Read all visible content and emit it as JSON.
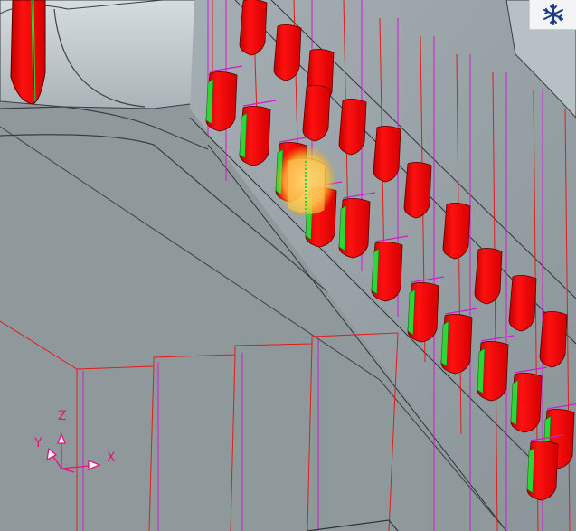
{
  "view_tool": {
    "icon": "navigation-cube-icon"
  },
  "triad": {
    "axis_x": "X",
    "axis_y": "Y",
    "axis_z": "Z"
  },
  "colors": {
    "background": "#8f999c",
    "part_surface": "#9aa4a8",
    "part_highlight": "#c3ccd0",
    "feature_red": "#ff0000",
    "feature_green": "#2fd635",
    "edge_magenta": "#d21ad2",
    "sketch_red": "#e31b1b",
    "selection_glow": "#ffd24a",
    "triad": "#e0157f"
  }
}
